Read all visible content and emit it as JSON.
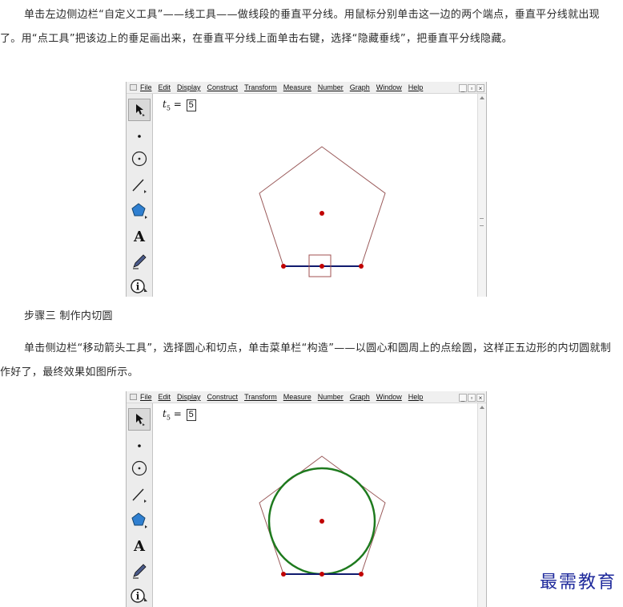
{
  "paragraphs": {
    "step_two_text": "单击左边侧边栏“自定义工具”——线工具——做线段的垂直平分线。用鼠标分别单击这一边的两个端点，垂直平分线就出现了。用“点工具”把该边上的垂足画出来，在垂直平分线上面单击右键，选择“隐藏垂线”，把垂直平分线隐藏。",
    "step_three_heading": "步骤三 制作内切圆",
    "step_three_text": "单击侧边栏“移动箭头工具”，选择圆心和切点，单击菜单栏“构造”——以圆心和圆周上的点绘圆，这样正五边形的内切圆就制作好了，最终效果如图所示。"
  },
  "sketchpad": {
    "menu": [
      "File",
      "Edit",
      "Display",
      "Construct",
      "Transform",
      "Measure",
      "Number",
      "Graph",
      "Window",
      "Help"
    ],
    "window_buttons": [
      "_",
      "▫",
      "×"
    ],
    "tools": [
      "arrow-tool",
      "point-tool",
      "compass-tool",
      "straightedge-tool",
      "polygon-tool",
      "text-tool",
      "marker-tool",
      "information-tool"
    ],
    "text_tool_glyph": "A",
    "info_tool_glyph": "i",
    "param_var": "t",
    "param_sub": "5",
    "param_eq": "=",
    "param_value": "5"
  },
  "colors": {
    "pentagon": "#9a5a5a",
    "point": "#c00000",
    "segment": "#101a6e",
    "circle": "#1e7a1e",
    "selection_box": "#a05050"
  },
  "watermark": "最需教育"
}
